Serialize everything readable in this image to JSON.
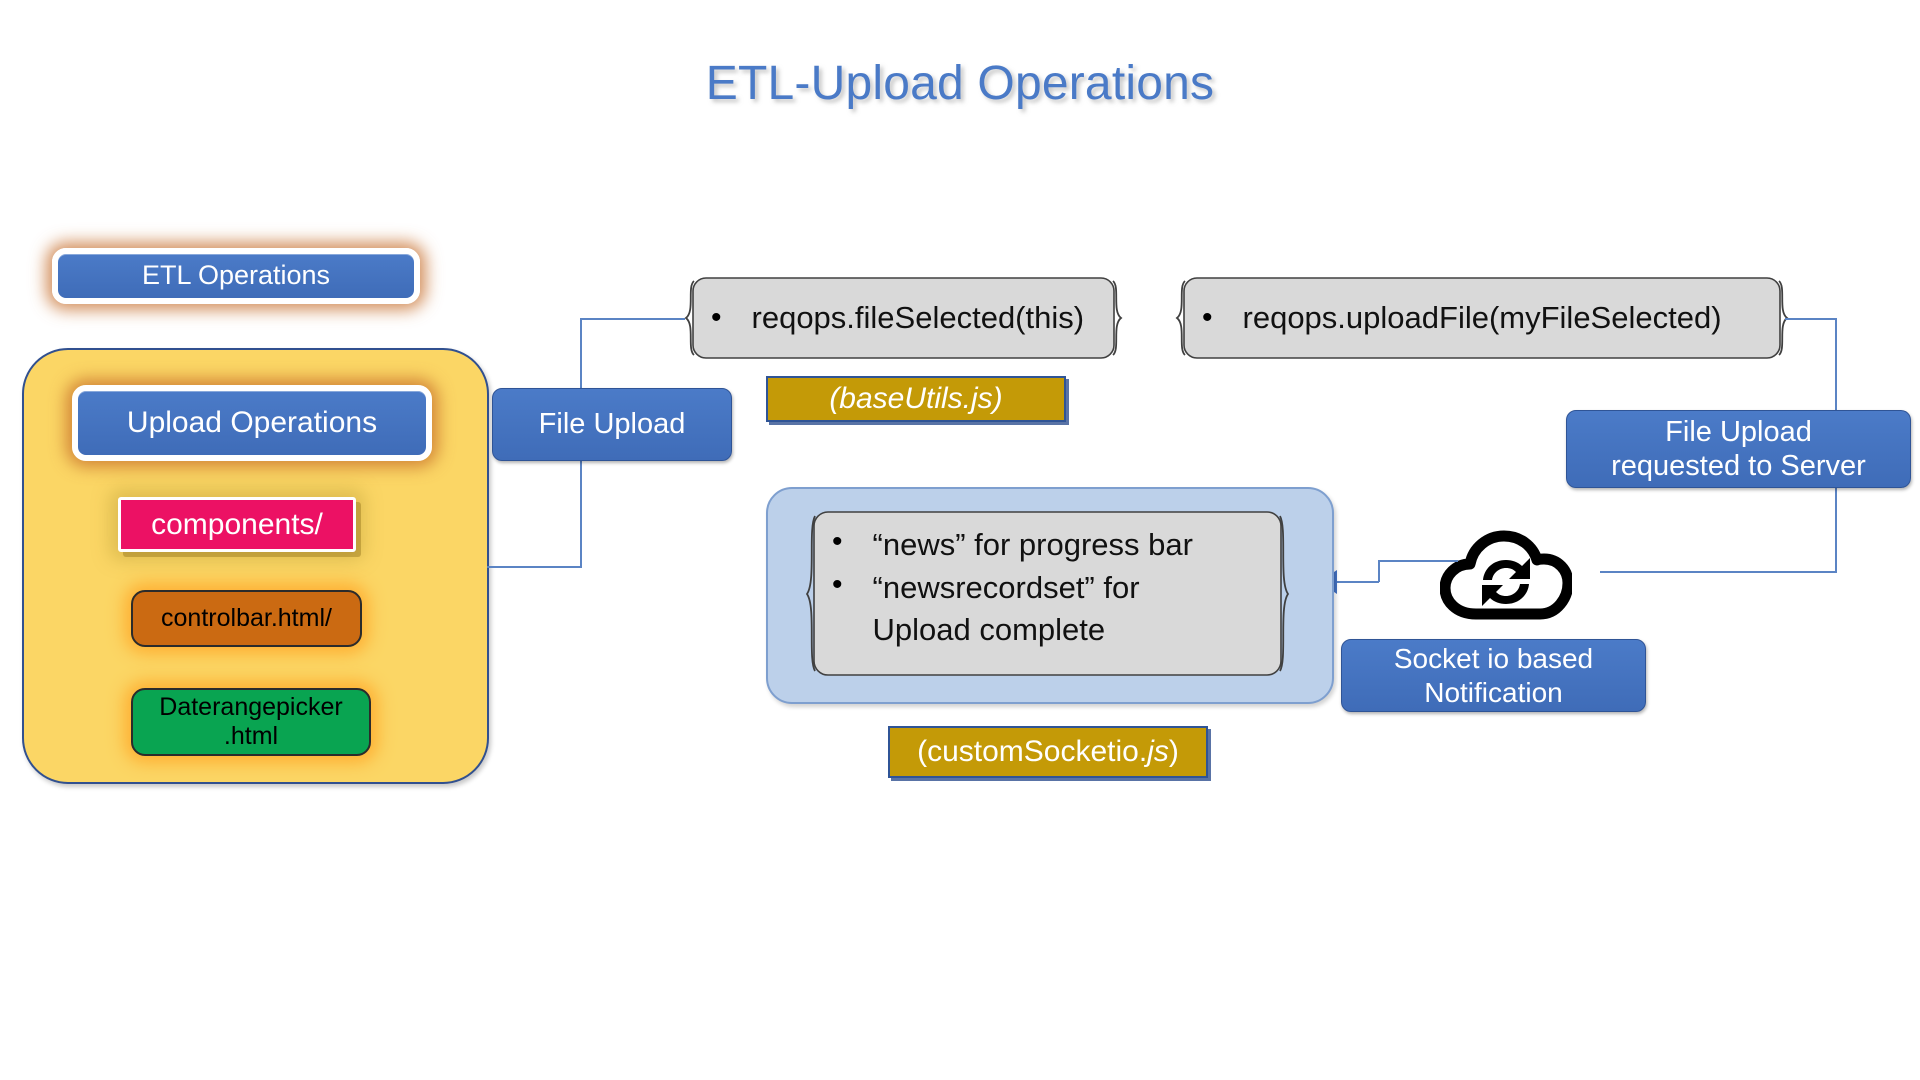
{
  "page": {
    "title": "ETL-Upload Operations",
    "title_color": "#4a7ac7",
    "background": "#ffffff"
  },
  "left_column": {
    "etl_operations_label": "ETL Operations",
    "panel": {
      "fill_color": "#fbd665",
      "upload_operations_label": "Upload Operations",
      "items": [
        {
          "label": "components/",
          "color": "#ec1164",
          "text_color": "#ffffff"
        },
        {
          "label": "controlbar.html/",
          "color": "#cb6a12",
          "text_color": "#000000"
        },
        {
          "label": "Daterangepicker\n.html",
          "line1": "Daterangepicker",
          "line2": ".html",
          "color": "#09a451",
          "text_color": "#000000"
        }
      ]
    }
  },
  "flow": {
    "file_upload_label": "File Upload",
    "file_upload_requested_label_line1": "File Upload",
    "file_upload_requested_label_line2": "requested to Server",
    "socket_notification_line1": "Socket io based",
    "socket_notification_line2": "Notification",
    "cloud_icon": "cloud-sync-icon"
  },
  "code_boxes": [
    {
      "bullet": "•",
      "text": "reqops.fileSelected(this)"
    },
    {
      "bullet": "•",
      "text": "reqops.uploadFile(myFileSelected)"
    }
  ],
  "news_box": {
    "items": [
      {
        "bullet": "•",
        "text": "“news” for progress bar"
      },
      {
        "bullet": "•",
        "line1": "“newsrecordset” for",
        "line2": "Upload complete"
      }
    ]
  },
  "notes": {
    "base_utils": {
      "prefix": "(",
      "name": "baseUtils.js",
      "suffix": ")",
      "full": "(baseUtils.js)"
    },
    "custom_socketio": {
      "prefix": "(customSocketio.",
      "name": "js",
      "suffix": ")",
      "full": "(customSocketio.js)"
    }
  },
  "colors": {
    "blue": "#4472C4",
    "yellow": "#fbd665",
    "pink": "#ec1164",
    "orange": "#cb6a12",
    "green": "#09a451",
    "gold": "#c49a07",
    "gray": "#d9d9d9",
    "light_blue": "#bcd0ea",
    "connector": "#5b84c4"
  }
}
